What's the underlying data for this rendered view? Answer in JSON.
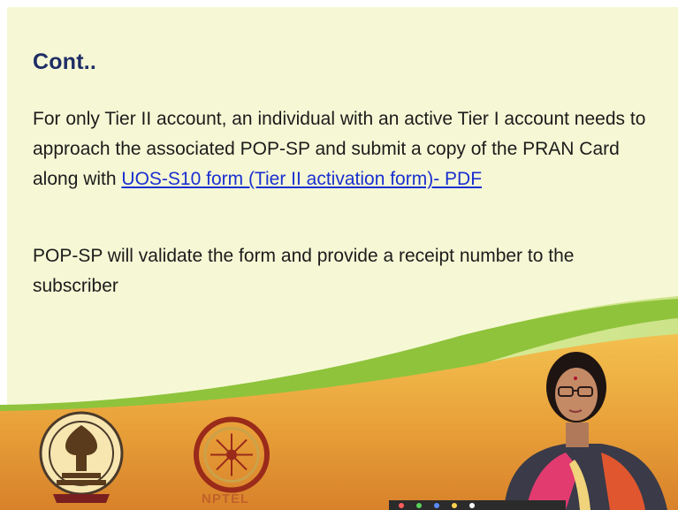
{
  "slide": {
    "title": "Cont..",
    "paragraph1_text": "For only Tier II account, an individual with an active Tier I account needs to approach the associated POP-SP and submit a copy of the PRAN Card along with ",
    "paragraph1_link": "UOS-S10 form (Tier II activation form)- PDF",
    "paragraph2_text": "POP-SP will validate the form and provide a receipt number to the subscriber"
  },
  "logos": {
    "left_logo_icon": "iit-kharagpur-emblem-icon",
    "right_logo_icon": "nptel-emblem-icon",
    "nptel_label": "NPTEL"
  },
  "colors": {
    "background": "#f6f8d5",
    "title": "#1f2e67",
    "link": "#1a2fd0",
    "wave_light": "#c9e36a",
    "wave_green": "#8fc33c",
    "banner_orange": "#e9a23a"
  }
}
